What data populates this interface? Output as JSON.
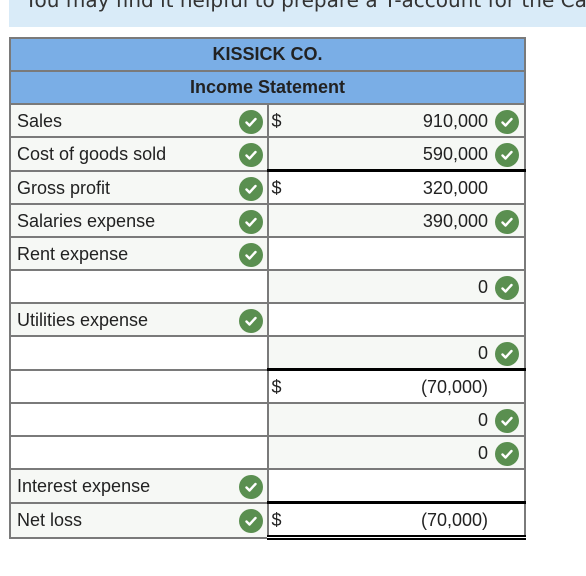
{
  "banner": {
    "text": "You may find it helpful to prepare a T-account for the Cas"
  },
  "header": {
    "company": "KISSICK CO.",
    "statement": "Income Statement"
  },
  "colors": {
    "header_bg": "#7aaee6",
    "check": "#5a8f50",
    "banner_bg": "#d9ebf8"
  },
  "rows": [
    {
      "label": "Sales",
      "label_check": true,
      "dollar": "$",
      "amount": "910,000",
      "amount_check": true
    },
    {
      "label": "Cost of goods sold",
      "label_check": true,
      "dollar": "",
      "amount": "590,000",
      "amount_check": true
    },
    {
      "label": "Gross profit",
      "label_check": true,
      "dollar": "$",
      "amount": "320,000",
      "amount_check": false,
      "top_rule": true
    },
    {
      "label": "Salaries expense",
      "label_check": true,
      "dollar": "",
      "amount": "390,000",
      "amount_check": true
    },
    {
      "label": "Rent expense",
      "label_check": true,
      "dollar": "",
      "amount": "",
      "amount_check": false
    },
    {
      "label": "",
      "label_check": false,
      "dollar": "",
      "amount": "0",
      "amount_check": true
    },
    {
      "label": "Utilities expense",
      "label_check": true,
      "dollar": "",
      "amount": "",
      "amount_check": false
    },
    {
      "label": "",
      "label_check": false,
      "dollar": "",
      "amount": "0",
      "amount_check": true
    },
    {
      "label": "",
      "label_check": false,
      "dollar": "$",
      "amount": "(70,000)",
      "amount_check": false,
      "top_rule": true
    },
    {
      "label": "",
      "label_check": false,
      "dollar": "",
      "amount": "0",
      "amount_check": true
    },
    {
      "label": "",
      "label_check": false,
      "dollar": "",
      "amount": "0",
      "amount_check": true
    },
    {
      "label": "Interest expense",
      "label_check": true,
      "dollar": "",
      "amount": "",
      "amount_check": false
    },
    {
      "label": "Net loss",
      "label_check": true,
      "dollar": "$",
      "amount": "(70,000)",
      "amount_check": false,
      "top_rule": true,
      "double_rule": true
    }
  ]
}
